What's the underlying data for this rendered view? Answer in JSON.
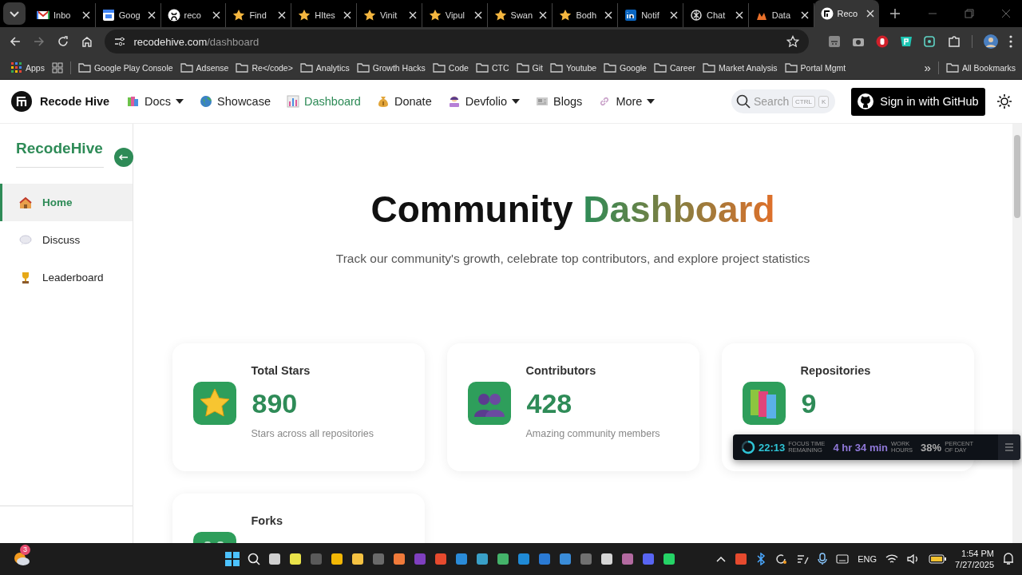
{
  "browser": {
    "tabs": [
      {
        "title": "Inbo",
        "selected": false
      },
      {
        "title": "Goog",
        "selected": false
      },
      {
        "title": "reco",
        "selected": false
      },
      {
        "title": "Find",
        "selected": false
      },
      {
        "title": "HItes",
        "selected": false
      },
      {
        "title": "Vinit",
        "selected": false
      },
      {
        "title": "Vipul",
        "selected": false
      },
      {
        "title": "Swan",
        "selected": false
      },
      {
        "title": "Bodh",
        "selected": false
      },
      {
        "title": "Notif",
        "selected": false
      },
      {
        "title": "Chat",
        "selected": false
      },
      {
        "title": "Data",
        "selected": false
      },
      {
        "title": "Reco",
        "selected": true
      }
    ],
    "address": {
      "host": "recodehive.com",
      "path": "/dashboard"
    },
    "bookmarks": {
      "apps": "Apps",
      "folders": [
        "Google Play Console",
        "Adsense",
        "Re</code>",
        "Analytics",
        "Growth Hacks",
        "Code",
        "CTC",
        "Git",
        "Youtube",
        "Google",
        "Career",
        "Market Analysis",
        "Portal Mgmt"
      ],
      "overflow": "»",
      "all": "All Bookmarks"
    }
  },
  "site_nav": {
    "brand": "Recode Hive",
    "items": [
      {
        "label": "Docs",
        "dropdown": true,
        "selected": false
      },
      {
        "label": "Showcase",
        "dropdown": false,
        "selected": false
      },
      {
        "label": "Dashboard",
        "dropdown": false,
        "selected": true
      },
      {
        "label": "Donate",
        "dropdown": false,
        "selected": false
      },
      {
        "label": "Devfolio",
        "dropdown": true,
        "selected": false
      },
      {
        "label": "Blogs",
        "dropdown": false,
        "selected": false
      },
      {
        "label": "More",
        "dropdown": true,
        "selected": false
      }
    ],
    "search": {
      "placeholder": "Search",
      "keys": [
        "CTRL",
        "K"
      ]
    },
    "sign_in": "Sign in with GitHub"
  },
  "sidebar": {
    "title": "RecodeHive",
    "items": [
      {
        "label": "Home",
        "selected": true
      },
      {
        "label": "Discuss",
        "selected": false
      },
      {
        "label": "Leaderboard",
        "selected": false
      }
    ]
  },
  "main": {
    "title": "Community",
    "title_highlight": "Dashboard",
    "subtitle": "Track our community's growth, celebrate top contributors, and explore project statistics",
    "stats": [
      {
        "label": "Total Stars",
        "value": "890",
        "caption": "Stars across all repositories"
      },
      {
        "label": "Contributors",
        "value": "428",
        "caption": "Amazing community members"
      },
      {
        "label": "Repositories",
        "value": "9"
      },
      {
        "label": "Forks"
      }
    ]
  },
  "focus_widget": {
    "timer": "22:13",
    "timer_label": [
      "FOCUS TIME",
      "REMAINING"
    ],
    "hours": "4 hr 34 min",
    "hours_label": [
      "WORK",
      "HOURS"
    ],
    "percent": "38%",
    "percent_label": [
      "PERCENT",
      "OF DAY"
    ]
  },
  "taskbar": {
    "notification_count": "3",
    "language": "ENG",
    "time": "1:54 PM",
    "date": "7/27/2025"
  }
}
